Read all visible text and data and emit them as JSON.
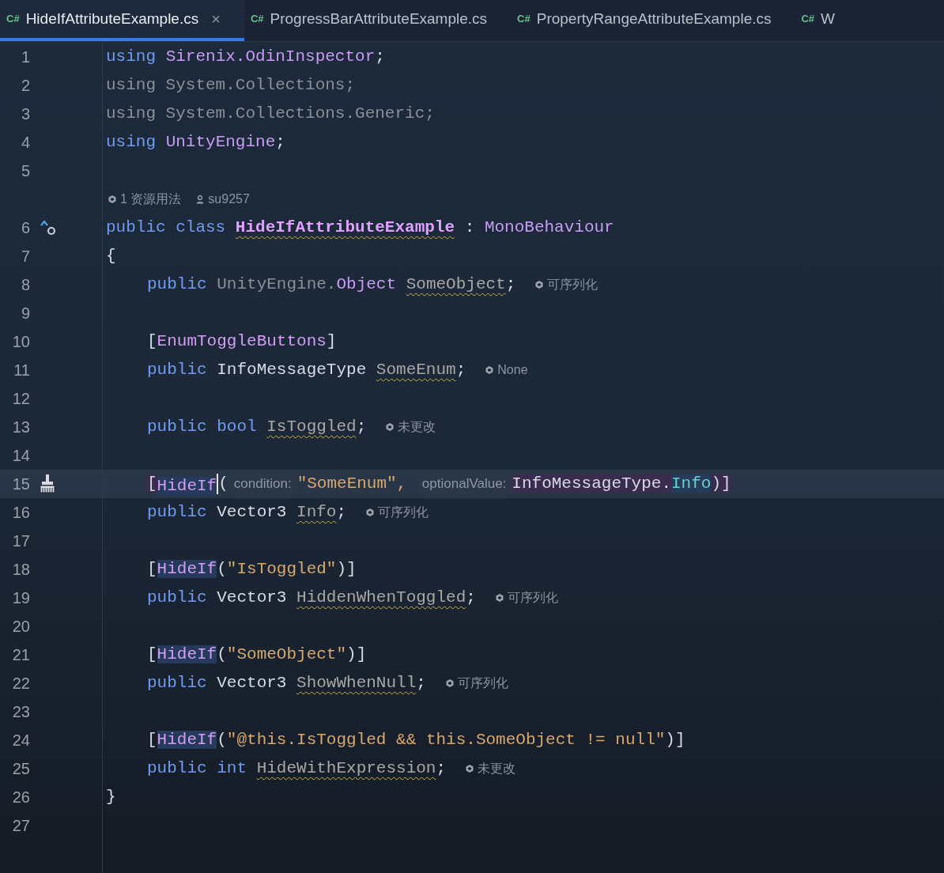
{
  "tabs": [
    {
      "icon": "C#",
      "label": "HideIfAttributeExample.cs",
      "selected": true,
      "closable": true,
      "close": "×"
    },
    {
      "icon": "C#",
      "label": "ProgressBarAttributeExample.cs",
      "selected": false,
      "closable": false
    },
    {
      "icon": "C#",
      "label": "PropertyRangeAttributeExample.cs",
      "selected": false,
      "closable": false
    },
    {
      "icon": "C#",
      "label": "W",
      "selected": false,
      "closable": false
    }
  ],
  "lines": [
    {
      "number": "1",
      "indented": false,
      "tokens": [
        {
          "text": "using ",
          "kind": "keyword"
        },
        {
          "text": "Sirenix.OdinInspector",
          "kind": "type"
        },
        {
          "text": ";",
          "kind": "plain"
        }
      ]
    },
    {
      "number": "2",
      "indented": false,
      "tokens": [
        {
          "text": "using System.Collections;",
          "kind": "unused"
        }
      ]
    },
    {
      "number": "3",
      "indented": false,
      "tokens": [
        {
          "text": "using System.Collections.Generic;",
          "kind": "unused"
        }
      ]
    },
    {
      "number": "4",
      "indented": false,
      "tokens": [
        {
          "text": "using ",
          "kind": "keyword"
        },
        {
          "text": "UnityEngine",
          "kind": "type"
        },
        {
          "text": ";",
          "kind": "plain"
        }
      ]
    },
    {
      "number": "5"
    },
    {
      "kind": "codelens",
      "items": [
        {
          "kind": "usages",
          "text": "1 资源用法"
        },
        {
          "kind": "author",
          "text": "su9257"
        }
      ]
    },
    {
      "number": "6",
      "indented": false,
      "gutter": {
        "kind": "hierarchy"
      },
      "tokens": [
        {
          "text": "public class ",
          "kind": "keyword"
        },
        {
          "text": "HideIfAttributeExample",
          "kind": "classname",
          "underlined": true
        },
        {
          "text": " : ",
          "kind": "plain"
        },
        {
          "text": "MonoBehaviour",
          "kind": "type"
        }
      ]
    },
    {
      "number": "7",
      "indented": false,
      "tokens": [
        {
          "text": "{",
          "kind": "plain"
        }
      ]
    },
    {
      "number": "8",
      "indented": true,
      "tokens": [
        {
          "text": "public ",
          "kind": "keyword"
        },
        {
          "text": "UnityEngine.",
          "kind": "unused"
        },
        {
          "text": "Object ",
          "kind": "type"
        },
        {
          "text": "SomeObject",
          "kind": "field",
          "underlined": true
        },
        {
          "text": ";",
          "kind": "plain"
        }
      ],
      "hint": "可序列化"
    },
    {
      "number": "9"
    },
    {
      "number": "10",
      "indented": true,
      "tokens": [
        {
          "text": "[",
          "kind": "plain"
        },
        {
          "text": "EnumToggleButtons",
          "kind": "attr"
        },
        {
          "text": "]",
          "kind": "plain"
        }
      ]
    },
    {
      "number": "11",
      "indented": true,
      "tokens": [
        {
          "text": "public ",
          "kind": "keyword"
        },
        {
          "text": "InfoMessageType ",
          "kind": "plain"
        },
        {
          "text": "SomeEnum",
          "kind": "field",
          "underlined": true
        },
        {
          "text": ";",
          "kind": "plain"
        }
      ],
      "hint": "None"
    },
    {
      "number": "12"
    },
    {
      "number": "13",
      "indented": true,
      "tokens": [
        {
          "text": "public bool ",
          "kind": "keyword"
        },
        {
          "text": "IsToggled",
          "kind": "field",
          "underlined": true
        },
        {
          "text": ";",
          "kind": "plain"
        }
      ],
      "hint": "未更改"
    },
    {
      "number": "14"
    },
    {
      "number": "15",
      "indented": true,
      "current": true,
      "gutter": {
        "kind": "broom"
      },
      "tokens": [
        {
          "text": "[",
          "kind": "plain",
          "highlighted": true
        },
        {
          "text": "HideIf",
          "kind": "attr",
          "highlighted": true,
          "caret": true
        },
        {
          "text": "(",
          "kind": "plain"
        },
        {
          "text": "condition:",
          "kind": "param_hint"
        },
        {
          "text": "\"SomeEnum\", ",
          "kind": "string"
        },
        {
          "text": "optionalValue:",
          "kind": "param_hint"
        },
        {
          "text": "InfoMessageType.",
          "kind": "plain",
          "highlighted": true
        },
        {
          "text": "Info",
          "kind": "member",
          "highlighted": true
        },
        {
          "text": ")]",
          "kind": "plain",
          "highlighted": true
        }
      ]
    },
    {
      "number": "16",
      "indented": true,
      "tokens": [
        {
          "text": "public ",
          "kind": "keyword"
        },
        {
          "text": "Vector3 ",
          "kind": "plain"
        },
        {
          "text": "Info",
          "kind": "field",
          "underlined": true
        },
        {
          "text": ";",
          "kind": "plain"
        }
      ],
      "hint": "可序列化"
    },
    {
      "number": "17"
    },
    {
      "number": "18",
      "indented": true,
      "tokens": [
        {
          "text": "[",
          "kind": "plain"
        },
        {
          "text": "HideIf",
          "kind": "attr",
          "highlighted": true
        },
        {
          "text": "(",
          "kind": "plain"
        },
        {
          "text": "\"IsToggled\"",
          "kind": "string"
        },
        {
          "text": ")]",
          "kind": "plain"
        }
      ]
    },
    {
      "number": "19",
      "indented": true,
      "tokens": [
        {
          "text": "public ",
          "kind": "keyword"
        },
        {
          "text": "Vector3 ",
          "kind": "plain"
        },
        {
          "text": "HiddenWhenToggled",
          "kind": "field",
          "underlined": true
        },
        {
          "text": ";",
          "kind": "plain"
        }
      ],
      "hint": "可序列化"
    },
    {
      "number": "20"
    },
    {
      "number": "21",
      "indented": true,
      "tokens": [
        {
          "text": "[",
          "kind": "plain"
        },
        {
          "text": "HideIf",
          "kind": "attr",
          "highlighted": true
        },
        {
          "text": "(",
          "kind": "plain"
        },
        {
          "text": "\"SomeObject\"",
          "kind": "string"
        },
        {
          "text": ")]",
          "kind": "plain"
        }
      ]
    },
    {
      "number": "22",
      "indented": true,
      "tokens": [
        {
          "text": "public ",
          "kind": "keyword"
        },
        {
          "text": "Vector3 ",
          "kind": "plain"
        },
        {
          "text": "ShowWhenNull",
          "kind": "field",
          "underlined": true
        },
        {
          "text": ";",
          "kind": "plain"
        }
      ],
      "hint": "可序列化"
    },
    {
      "number": "23"
    },
    {
      "number": "24",
      "indented": true,
      "tokens": [
        {
          "text": "[",
          "kind": "plain"
        },
        {
          "text": "HideIf",
          "kind": "attr",
          "highlighted": true
        },
        {
          "text": "(",
          "kind": "plain"
        },
        {
          "text": "\"@this.IsToggled && this.SomeObject != null\"",
          "kind": "string"
        },
        {
          "text": ")]",
          "kind": "plain"
        }
      ]
    },
    {
      "number": "25",
      "indented": true,
      "tokens": [
        {
          "text": "public int ",
          "kind": "keyword"
        },
        {
          "text": "HideWithExpression",
          "kind": "field",
          "underlined": true
        },
        {
          "text": ";",
          "kind": "plain"
        }
      ],
      "hint": "未更改"
    },
    {
      "number": "26",
      "indented": false,
      "tokens": [
        {
          "text": "}",
          "kind": "plain"
        }
      ]
    },
    {
      "number": "27"
    }
  ]
}
